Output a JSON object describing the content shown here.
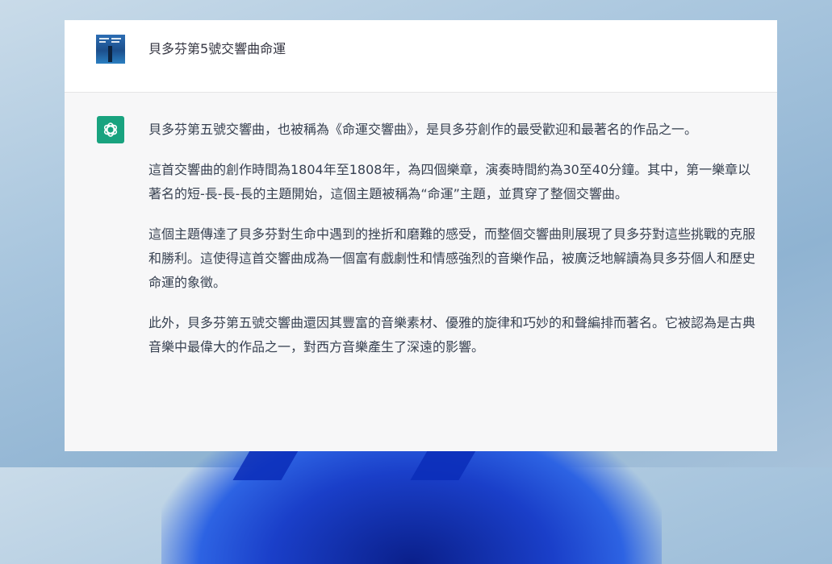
{
  "conversation": {
    "user_message": "貝多芬第5號交響曲命運",
    "assistant_paragraphs": [
      "貝多芬第五號交響曲，也被稱為《命運交響曲》，是貝多芬創作的最受歡迎和最著名的作品之一。",
      "這首交響曲的創作時間為1804年至1808年，為四個樂章，演奏時間約為30至40分鐘。其中，第一樂章以著名的短-長-長-長的主題開始，這個主題被稱為“命運”主題，並貫穿了整個交響曲。",
      "這個主題傳達了貝多芬對生命中遇到的挫折和磨難的感受，而整個交響曲則展現了貝多芬對這些挑戰的克服和勝利。這使得這首交響曲成為一個富有戲劇性和情感強烈的音樂作品，被廣泛地解讀為貝多芬個人和歷史命運的象徵。",
      "此外，貝多芬第五號交響曲還因其豐富的音樂素材、優雅的旋律和巧妙的和聲編排而著名。它被認為是古典音樂中最偉大的作品之一，對西方音樂產生了深遠的影響。"
    ]
  },
  "icons": {
    "user_avatar": "user-avatar-image",
    "assistant": "openai-logo-icon"
  },
  "colors": {
    "assistant_icon_bg": "#19a37f",
    "user_row_bg": "#ffffff",
    "assistant_row_bg": "#f7f7f8",
    "text": "#374151"
  }
}
